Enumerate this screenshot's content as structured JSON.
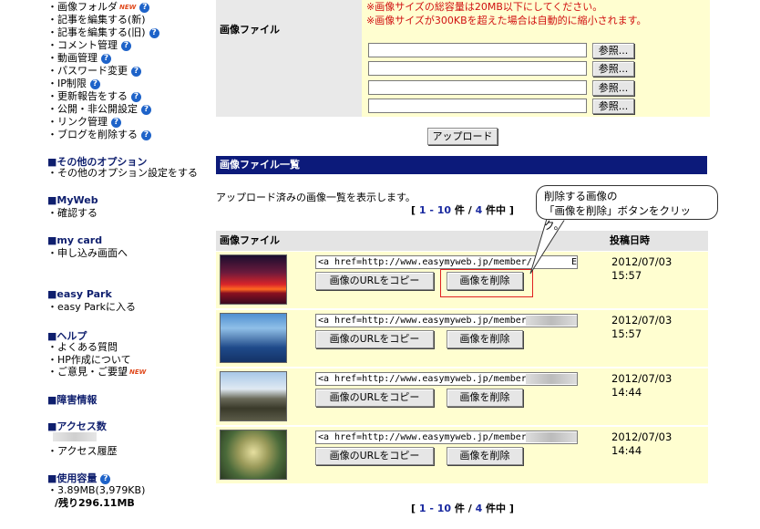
{
  "sidebar": {
    "links_top": [
      {
        "label": "画像フォルダ",
        "new": "NEW",
        "help": "?"
      },
      {
        "label": "記事を編集する(新)"
      },
      {
        "label": "記事を編集する(旧)",
        "help": "?"
      },
      {
        "label": "コメント管理",
        "help": "?"
      },
      {
        "label": "動画管理",
        "help": "?"
      },
      {
        "label": "パスワード変更",
        "help": "?"
      },
      {
        "label": "IP制限",
        "help": "?"
      },
      {
        "label": "更新報告をする",
        "help": "?"
      },
      {
        "label": "公開・非公開設定",
        "help": "?"
      },
      {
        "label": "リンク管理",
        "help": "?"
      },
      {
        "label": "ブログを削除する",
        "help": "?"
      }
    ],
    "options_head": "■その他のオプション",
    "options_link": "・その他のオプション設定をする",
    "myweb_head": "■MyWeb",
    "myweb_link": "・確認する",
    "mycard_head": "■my card",
    "mycard_link": "・申し込み画面へ",
    "easypark_head": "■easy Park",
    "easypark_link": "・easy Parkに入る",
    "help_head": "■ヘルプ",
    "help_link1": "・よくある質問",
    "help_link2": "・HP作成について",
    "help_link3": "・ご意見・ご要望",
    "help_link3_new": "NEW",
    "trouble_head": "■障害情報",
    "access_head": "■アクセス数",
    "access_link": "・アクセス履歴",
    "usage_head": "■使用容量",
    "usage_help": "?",
    "usage_value": "・3.89MB(3,979KB)",
    "usage_remaining": "/残り296.11MB"
  },
  "upload": {
    "label": "画像ファイル",
    "note1": "※画像サイズの総容量は20MB以下にしてください。",
    "note2": "※画像サイズが300KBを超えた場合は自動的に縮小されます。",
    "browse_label": "参照...",
    "submit_label": "アップロード"
  },
  "list": {
    "section_title": "画像ファイル一覧",
    "description": "アップロード済みの画像一覧を表示します。",
    "pager": {
      "open": "[ ",
      "range": "1 - 10",
      "unit": " 件 / ",
      "total": "4",
      "suffix": " 件中 ]"
    },
    "col_file": "画像ファイル",
    "col_date": "投稿日時",
    "copy_label": "画像のURLをコピー",
    "delete_label": "画像を削除",
    "rows": [
      {
        "url": "<a href=http://www.easymyweb.jp/member/",
        "url_tail": "E",
        "date": "2012/07/03",
        "time": "15:57"
      },
      {
        "url": "<a href=http://www.easymyweb.jp/member/",
        "url_tail": "",
        "date": "2012/07/03",
        "time": "15:57"
      },
      {
        "url": "<a href=http://www.easymyweb.jp/member/",
        "url_tail": "",
        "date": "2012/07/03",
        "time": "14:44"
      },
      {
        "url": "<a href=http://www.easymyweb.jp/member/",
        "url_tail": "",
        "date": "2012/07/03",
        "time": "14:44"
      }
    ]
  },
  "callout": {
    "line1": "削除する画像の",
    "line2": "「画像を削除」ボタンをクリック。"
  }
}
